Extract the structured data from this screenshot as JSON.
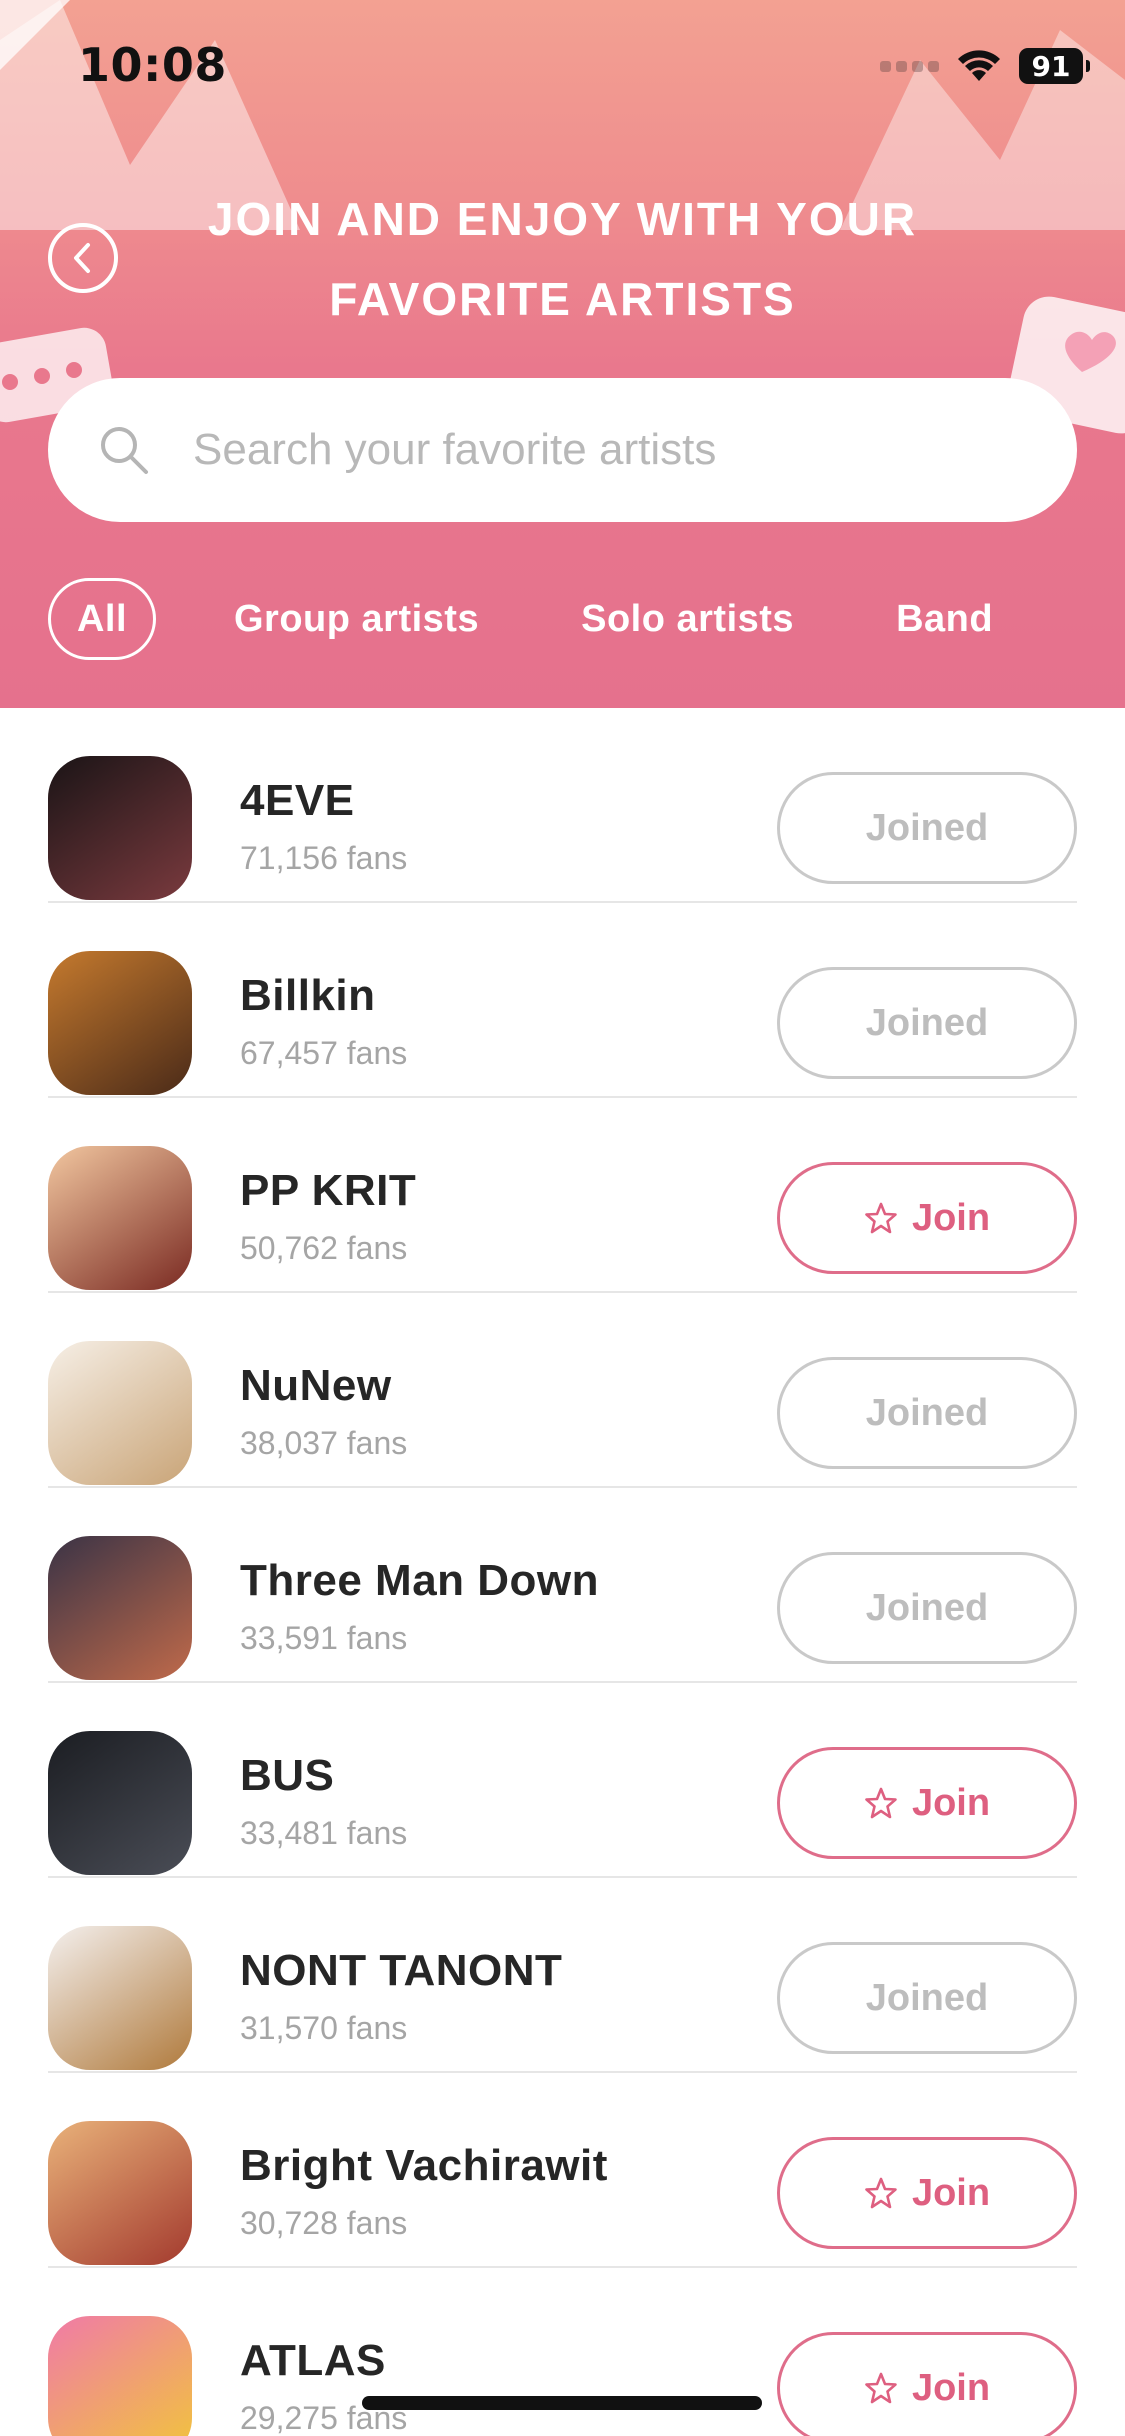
{
  "status_bar": {
    "time": "10:08",
    "battery": "91"
  },
  "header": {
    "title_line1": "JOIN AND ENJOY WITH YOUR",
    "title_line2": "FAVORITE ARTISTS"
  },
  "search": {
    "placeholder": "Search your favorite artists",
    "value": ""
  },
  "filters": [
    {
      "label": "All",
      "active": true
    },
    {
      "label": "Group artists",
      "active": false
    },
    {
      "label": "Solo artists",
      "active": false
    },
    {
      "label": "Band",
      "active": false
    }
  ],
  "colors": {
    "accent_pink": "#de5f80",
    "header_top": "#f3a192",
    "header_bottom": "#e5718d",
    "joined_gray": "#bdbdbd"
  },
  "artists": [
    {
      "name": "4EVE",
      "fans": "71,156 fans",
      "button": "Joined",
      "joined": true,
      "avatar_colors": [
        "#1a1416",
        "#7a3a3e"
      ]
    },
    {
      "name": "Billkin",
      "fans": "67,457 fans",
      "button": "Joined",
      "joined": true,
      "avatar_colors": [
        "#c57a2e",
        "#4a2a18"
      ]
    },
    {
      "name": "PP KRIT",
      "fans": "50,762 fans",
      "button": "Join",
      "joined": false,
      "avatar_colors": [
        "#f2c7a0",
        "#7a2a22"
      ]
    },
    {
      "name": "NuNew",
      "fans": "38,037 fans",
      "button": "Joined",
      "joined": true,
      "avatar_colors": [
        "#f6efe6",
        "#c9a477"
      ]
    },
    {
      "name": "Three Man Down",
      "fans": "33,591 fans",
      "button": "Joined",
      "joined": true,
      "avatar_colors": [
        "#3a3346",
        "#c06a4a"
      ]
    },
    {
      "name": "BUS",
      "fans": "33,481 fans",
      "button": "Join",
      "joined": false,
      "avatar_colors": [
        "#1b1d22",
        "#4a4d56"
      ]
    },
    {
      "name": "NONT TANONT",
      "fans": "31,570 fans",
      "button": "Joined",
      "joined": true,
      "avatar_colors": [
        "#f4f0ee",
        "#b07a3c"
      ]
    },
    {
      "name": "Bright Vachirawit",
      "fans": "30,728 fans",
      "button": "Join",
      "joined": false,
      "avatar_colors": [
        "#e9b27a",
        "#a33a2e"
      ]
    },
    {
      "name": "ATLAS",
      "fans": "29,275 fans",
      "button": "Join",
      "joined": false,
      "avatar_colors": [
        "#f07aa8",
        "#f1c63a"
      ]
    }
  ]
}
